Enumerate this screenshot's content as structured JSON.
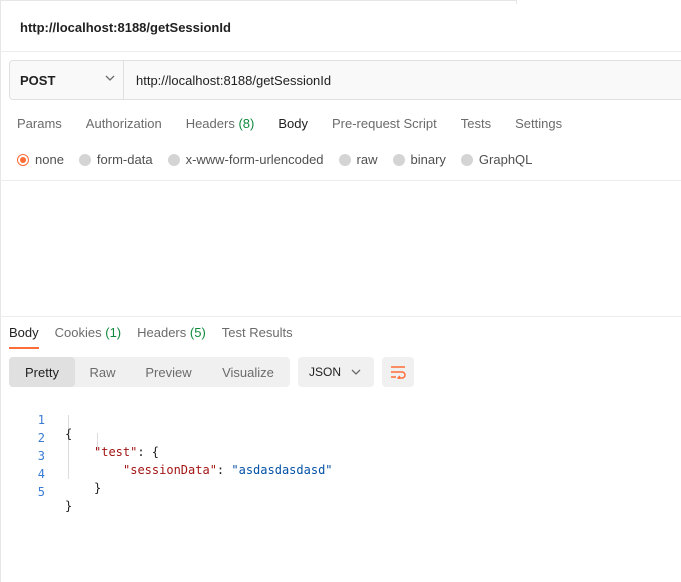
{
  "request": {
    "title": "http://localhost:8188/getSessionId",
    "method": "POST",
    "url": "http://localhost:8188/getSessionId"
  },
  "request_tabs": [
    {
      "label": "Params",
      "count": ""
    },
    {
      "label": "Authorization",
      "count": ""
    },
    {
      "label": "Headers",
      "count": "(8)"
    },
    {
      "label": "Body",
      "count": ""
    },
    {
      "label": "Pre-request Script",
      "count": ""
    },
    {
      "label": "Tests",
      "count": ""
    },
    {
      "label": "Settings",
      "count": ""
    }
  ],
  "active_request_tab": "Body",
  "body_types": [
    {
      "label": "none",
      "selected": true
    },
    {
      "label": "form-data",
      "selected": false
    },
    {
      "label": "x-www-form-urlencoded",
      "selected": false
    },
    {
      "label": "raw",
      "selected": false
    },
    {
      "label": "binary",
      "selected": false
    },
    {
      "label": "GraphQL",
      "selected": false
    }
  ],
  "response_tabs": [
    {
      "label": "Body",
      "count": ""
    },
    {
      "label": "Cookies",
      "count": "(1)"
    },
    {
      "label": "Headers",
      "count": "(5)"
    },
    {
      "label": "Test Results",
      "count": ""
    }
  ],
  "view_modes": [
    "Pretty",
    "Raw",
    "Preview",
    "Visualize"
  ],
  "active_view_mode": "Pretty",
  "format": "JSON",
  "code_lines": [
    {
      "num": "1",
      "text": "{"
    },
    {
      "num": "2",
      "key": "\"test\"",
      "rest": ": {"
    },
    {
      "num": "3",
      "key": "\"sessionData\"",
      "sep": ": ",
      "value": "\"asdasdasdasd\""
    },
    {
      "num": "4",
      "text": "}"
    },
    {
      "num": "5",
      "text": "}"
    }
  ],
  "colors": {
    "accent": "#ff6c37",
    "count_green": "#0f8a3d",
    "line_number": "#3a7bd5",
    "json_key": "#a31515",
    "json_string": "#0451a5"
  },
  "icons": {
    "method_dropdown": "chevron-down-icon",
    "format_dropdown": "chevron-down-icon",
    "wrap": "wrap-lines-icon"
  }
}
